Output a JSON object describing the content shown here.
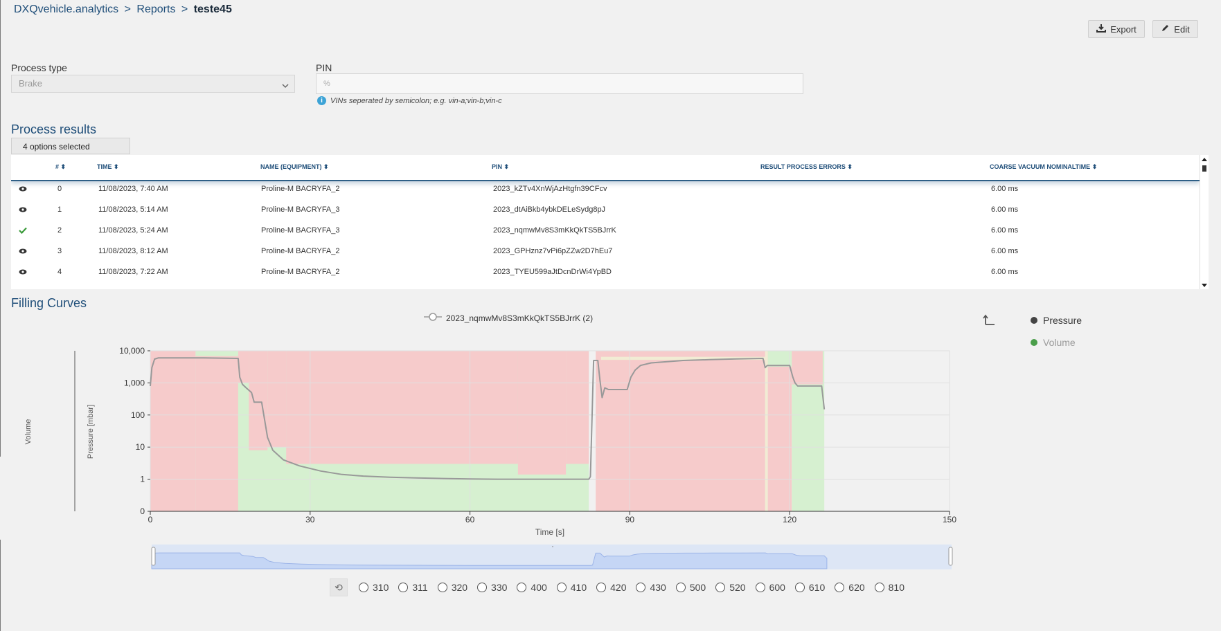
{
  "breadcrumb": {
    "app": "DXQvehicle.analytics",
    "sep1": ">",
    "reports": "Reports",
    "sep2": ">",
    "current": "teste45"
  },
  "toolbar": {
    "export_label": "Export",
    "edit_label": "Edit"
  },
  "filters": {
    "process_type_label": "Process type",
    "process_type_value": "Brake",
    "pin_label": "PIN",
    "pin_placeholder": "%",
    "pin_hint": "VINs seperated by semicolon; e.g. vin-a;vin-b;vin-c"
  },
  "results": {
    "title": "Process results",
    "options_selected": "4 options selected",
    "columns": [
      "#",
      "TIME",
      "NAME (EQUIPMENT)",
      "PIN",
      "RESULT PROCESS ERRORS",
      "COARSE VACUUM NOMINALTIME"
    ],
    "rows": [
      {
        "icon": "eye-icon",
        "num": "0",
        "time": "11/08/2023, 7:40 AM",
        "name": "Proline-M BACRYFA_2",
        "pin": "2023_kZTv4XnWjAzHtgfn39CFcv",
        "errors": "",
        "coarse": "6.00 ms"
      },
      {
        "icon": "eye-icon",
        "num": "1",
        "time": "11/08/2023, 5:14 AM",
        "name": "Proline-M BACRYFA_3",
        "pin": "2023_dtAiBkb4ybkDELeSydg8pJ",
        "errors": "",
        "coarse": "6.00 ms"
      },
      {
        "icon": "check-icon",
        "num": "2",
        "time": "11/08/2023, 5:24 AM",
        "name": "Proline-M BACRYFA_3",
        "pin": "2023_nqmwMv8S3mKkQkTS5BJrrK",
        "errors": "",
        "coarse": "6.00 ms"
      },
      {
        "icon": "eye-icon",
        "num": "3",
        "time": "11/08/2023, 8:12 AM",
        "name": "Proline-M BACRYFA_2",
        "pin": "2023_GPHznz7vPi6pZZw2D7hEu7",
        "errors": "",
        "coarse": "6.00 ms"
      },
      {
        "icon": "eye-icon",
        "num": "4",
        "time": "11/08/2023, 7:22 AM",
        "name": "Proline-M BACRYFA_2",
        "pin": "2023_TYEU599aJtDcnDrWi4YpBD",
        "errors": "",
        "coarse": "6.00 ms"
      }
    ]
  },
  "filling": {
    "title": "Filling Curves",
    "series_label": "2023_nqmwMv8S3mKkQkTS5BJrrK (2)",
    "legend": [
      {
        "name": "Pressure",
        "color": "#444444"
      },
      {
        "name": "Volume",
        "color": "#4a9e4a"
      }
    ],
    "toggles": [
      "310",
      "311",
      "320",
      "330",
      "400",
      "410",
      "420",
      "430",
      "500",
      "520",
      "600",
      "610",
      "620",
      "810"
    ]
  },
  "chart_data": {
    "type": "line",
    "title": "",
    "xlabel": "Time [s]",
    "ylabel": "Pressure [mbar]",
    "y2label": "Volume",
    "xlim": [
      0,
      150
    ],
    "xticks": [
      0,
      30,
      60,
      90,
      120,
      150
    ],
    "y_scale": "log",
    "yticks": [
      "0",
      "1",
      "10",
      "100",
      "1,000",
      "10,000"
    ],
    "ytick_values": [
      0.1,
      1,
      10,
      100,
      1000,
      10000
    ],
    "grid": true,
    "series": [
      {
        "name": "Pressure",
        "x": [
          0,
          0.3,
          0.8,
          1.5,
          5,
          10,
          16.5,
          16.8,
          17.3,
          18,
          19,
          19.5,
          20.5,
          20.9,
          21.3,
          22,
          23,
          25,
          28,
          32,
          36,
          40,
          45,
          50,
          55,
          60,
          65,
          70,
          75,
          80,
          82.3,
          82.6,
          83.2,
          83.6,
          84,
          84.4,
          84.8,
          85.3,
          86,
          88,
          89.5,
          90.2,
          91,
          92,
          94,
          100,
          105,
          110,
          115,
          115.4,
          115.8,
          120,
          120.6,
          121,
          121.5,
          123,
          126,
          126.5
        ],
        "y": [
          800,
          3000,
          5500,
          6000,
          6000,
          6000,
          5800,
          1500,
          900,
          700,
          500,
          250,
          250,
          250,
          100,
          20,
          8,
          4,
          2.6,
          1.8,
          1.4,
          1.25,
          1.15,
          1.1,
          1.05,
          1.02,
          1.0,
          1.0,
          1.0,
          1.0,
          1.0,
          1.2,
          5000,
          5000,
          5000,
          1200,
          350,
          700,
          620,
          620,
          620,
          1500,
          2500,
          3500,
          4200,
          5000,
          5300,
          5600,
          5800,
          3000,
          3500,
          3500,
          1500,
          1000,
          800,
          800,
          800,
          150
        ]
      }
    ],
    "bands": [
      {
        "x0": 0,
        "x1": 8.5,
        "y0": 0.1,
        "y1": 10000,
        "color": "#f6cbcb"
      },
      {
        "x0": 8.5,
        "x1": 16.5,
        "y0": 0.1,
        "y1": 10000,
        "color": "#d6f0d0"
      },
      {
        "x0": 8.5,
        "x1": 16.5,
        "y0": 0.1,
        "y1": 6800,
        "color": "#f6cbcb"
      },
      {
        "x0": 16.5,
        "x1": 82.3,
        "y0": 0.1,
        "y1": 10000,
        "color": "#d6f0d0"
      },
      {
        "x0": 16.5,
        "x1": 18.5,
        "y0": 1000,
        "y1": 10000,
        "color": "#f6cbcb"
      },
      {
        "x0": 18.5,
        "x1": 22,
        "y0": 8,
        "y1": 10000,
        "color": "#f6cbcb"
      },
      {
        "x0": 22,
        "x1": 25.5,
        "y0": 10,
        "y1": 10000,
        "color": "#f6cbcb"
      },
      {
        "x0": 25.5,
        "x1": 69,
        "y0": 3,
        "y1": 10000,
        "color": "#f6cbcb"
      },
      {
        "x0": 69,
        "x1": 78,
        "y0": 1.4,
        "y1": 10000,
        "color": "#f6cbcb"
      },
      {
        "x0": 78,
        "x1": 82.3,
        "y0": 3,
        "y1": 10000,
        "color": "#f6cbcb"
      },
      {
        "x0": 83.6,
        "x1": 115.4,
        "y0": 0.1,
        "y1": 10000,
        "color": "#f6cbcb"
      },
      {
        "x0": 84.6,
        "x1": 115.4,
        "y0": 5200,
        "y1": 6500,
        "color": "#f1ecd4"
      },
      {
        "x0": 115.4,
        "x1": 115.9,
        "y0": 0.1,
        "y1": 10000,
        "color": "#f1ecd4"
      },
      {
        "x0": 115.9,
        "x1": 120.4,
        "y0": 0.1,
        "y1": 10000,
        "color": "#f6cbcb"
      },
      {
        "x0": 115.9,
        "x1": 120.4,
        "y0": 3200,
        "y1": 10000,
        "color": "#d6f0d0"
      },
      {
        "x0": 120.4,
        "x1": 126.5,
        "y0": 0.1,
        "y1": 10000,
        "color": "#d6f0d0"
      },
      {
        "x0": 120.4,
        "x1": 126.2,
        "y0": 900,
        "y1": 10000,
        "color": "#f6cbcb"
      }
    ]
  }
}
